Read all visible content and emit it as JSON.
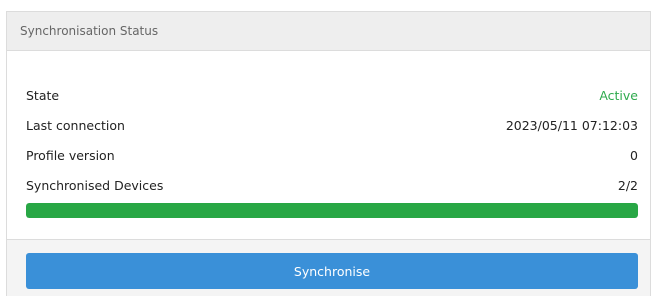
{
  "panel": {
    "title": "Synchronisation Status"
  },
  "status": {
    "rows": [
      {
        "label": "State",
        "value": "Active"
      },
      {
        "label": "Last connection",
        "value": "2023/05/11 07:12:03"
      },
      {
        "label": "Profile version",
        "value": "0"
      },
      {
        "label": "Synchronised Devices",
        "value": "2/2"
      }
    ],
    "progress_fraction": 1.0
  },
  "actions": {
    "synchronise_label": "Synchronise"
  },
  "colors": {
    "active_text": "#2eaa4d",
    "progress_fill": "#28a745",
    "button_bg": "#3a90d8"
  }
}
